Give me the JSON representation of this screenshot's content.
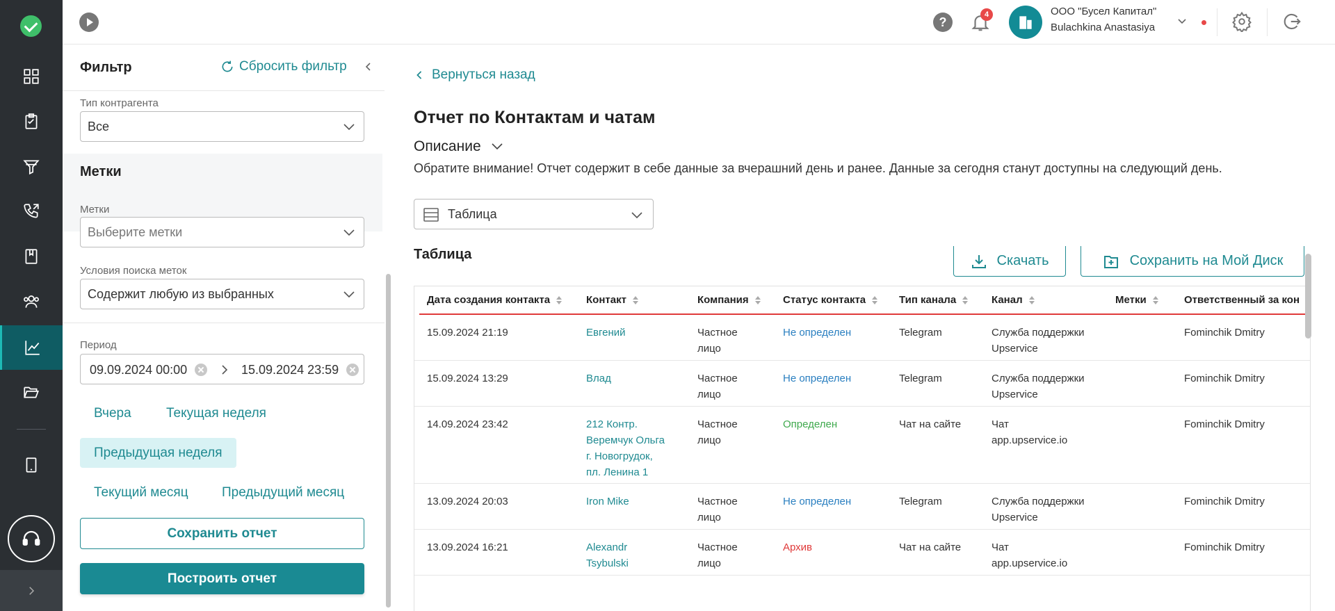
{
  "colors": {
    "accent": "#1f8a91",
    "rail_bg": "#2b2f33",
    "status_undefined": "#2a7fc0",
    "status_defined": "#3fa94d",
    "status_archive": "#e03a3a"
  },
  "topbar": {
    "notifications_count": "4",
    "company_name": "ООО \"Бусел Капитал\"",
    "user_name": "Bulachkina Anastasiya"
  },
  "filter": {
    "title": "Фильтр",
    "reset_label": "Сбросить фильтр",
    "contractor_type": {
      "label": "Тип контрагента",
      "value": "Все"
    },
    "tags_section_title": "Метки",
    "tags": {
      "label": "Метки",
      "placeholder": "Выберите метки"
    },
    "tag_search": {
      "label": "Условия поиска меток",
      "value": "Содержит любую из выбранных"
    },
    "period": {
      "label": "Период",
      "from": "09.09.2024 00:00",
      "to": "15.09.2024 23:59"
    },
    "quick_periods": {
      "yesterday": "Вчера",
      "current_week": "Текущая неделя",
      "previous_week": "Предыдущая неделя",
      "current_month": "Текущий месяц",
      "previous_month": "Предыдущий месяц"
    },
    "save_report": "Сохранить отчет",
    "build_report": "Построить отчет"
  },
  "main": {
    "back_label": "Вернуться назад",
    "title": "Отчет по Контактам и чатам",
    "description_toggle": "Описание",
    "description_text": "Обратите внимание! Отчет содержит в себе данные за вчерашний день и ранее. Данные за сегодня станут доступны на следующий день.",
    "view_select": "Таблица",
    "table_heading": "Таблица",
    "download_label": "Скачать",
    "save_disk_label": "Сохранить на Мой Диск",
    "columns": {
      "created": "Дата создания контакта",
      "contact": "Контакт",
      "company": "Компания",
      "status": "Статус контакта",
      "channel_type": "Тип канала",
      "channel": "Канал",
      "tags": "Метки",
      "responsible": "Ответственный за кон"
    },
    "rows": [
      {
        "created": "15.09.2024 21:19",
        "contact": [
          "Евгений"
        ],
        "company": [
          "Частное",
          "лицо"
        ],
        "status": "Не определен",
        "channel_type": "Telegram",
        "channel": [
          "Служба поддержки",
          "Upservice"
        ],
        "responsible": "Fominchik Dmitry"
      },
      {
        "created": "15.09.2024 13:29",
        "contact": [
          "Влад"
        ],
        "company": [
          "Частное",
          "лицо"
        ],
        "status": "Не определен",
        "channel_type": "Telegram",
        "channel": [
          "Служба поддержки",
          "Upservice"
        ],
        "responsible": "Fominchik Dmitry"
      },
      {
        "created": "14.09.2024 23:42",
        "contact": [
          "212 Контр.",
          "Веремчук Ольга",
          "г. Новогрудок,",
          "пл. Ленина 1"
        ],
        "company": [
          "Частное",
          "лицо"
        ],
        "status": "Определен",
        "channel_type": "Чат на сайте",
        "channel": [
          "Чат",
          "app.upservice.io"
        ],
        "responsible": "Fominchik Dmitry"
      },
      {
        "created": "13.09.2024 20:03",
        "contact": [
          "Iron Mike"
        ],
        "company": [
          "Частное",
          "лицо"
        ],
        "status": "Не определен",
        "channel_type": "Telegram",
        "channel": [
          "Служба поддержки",
          "Upservice"
        ],
        "responsible": "Fominchik Dmitry"
      },
      {
        "created": "13.09.2024 16:21",
        "contact": [
          "Alexandr",
          "Tsybulski"
        ],
        "company": [
          "Частное",
          "лицо"
        ],
        "status": "Архив",
        "channel_type": "Чат на сайте",
        "channel": [
          "Чат",
          "app.upservice.io"
        ],
        "responsible": "Fominchik Dmitry"
      }
    ]
  }
}
